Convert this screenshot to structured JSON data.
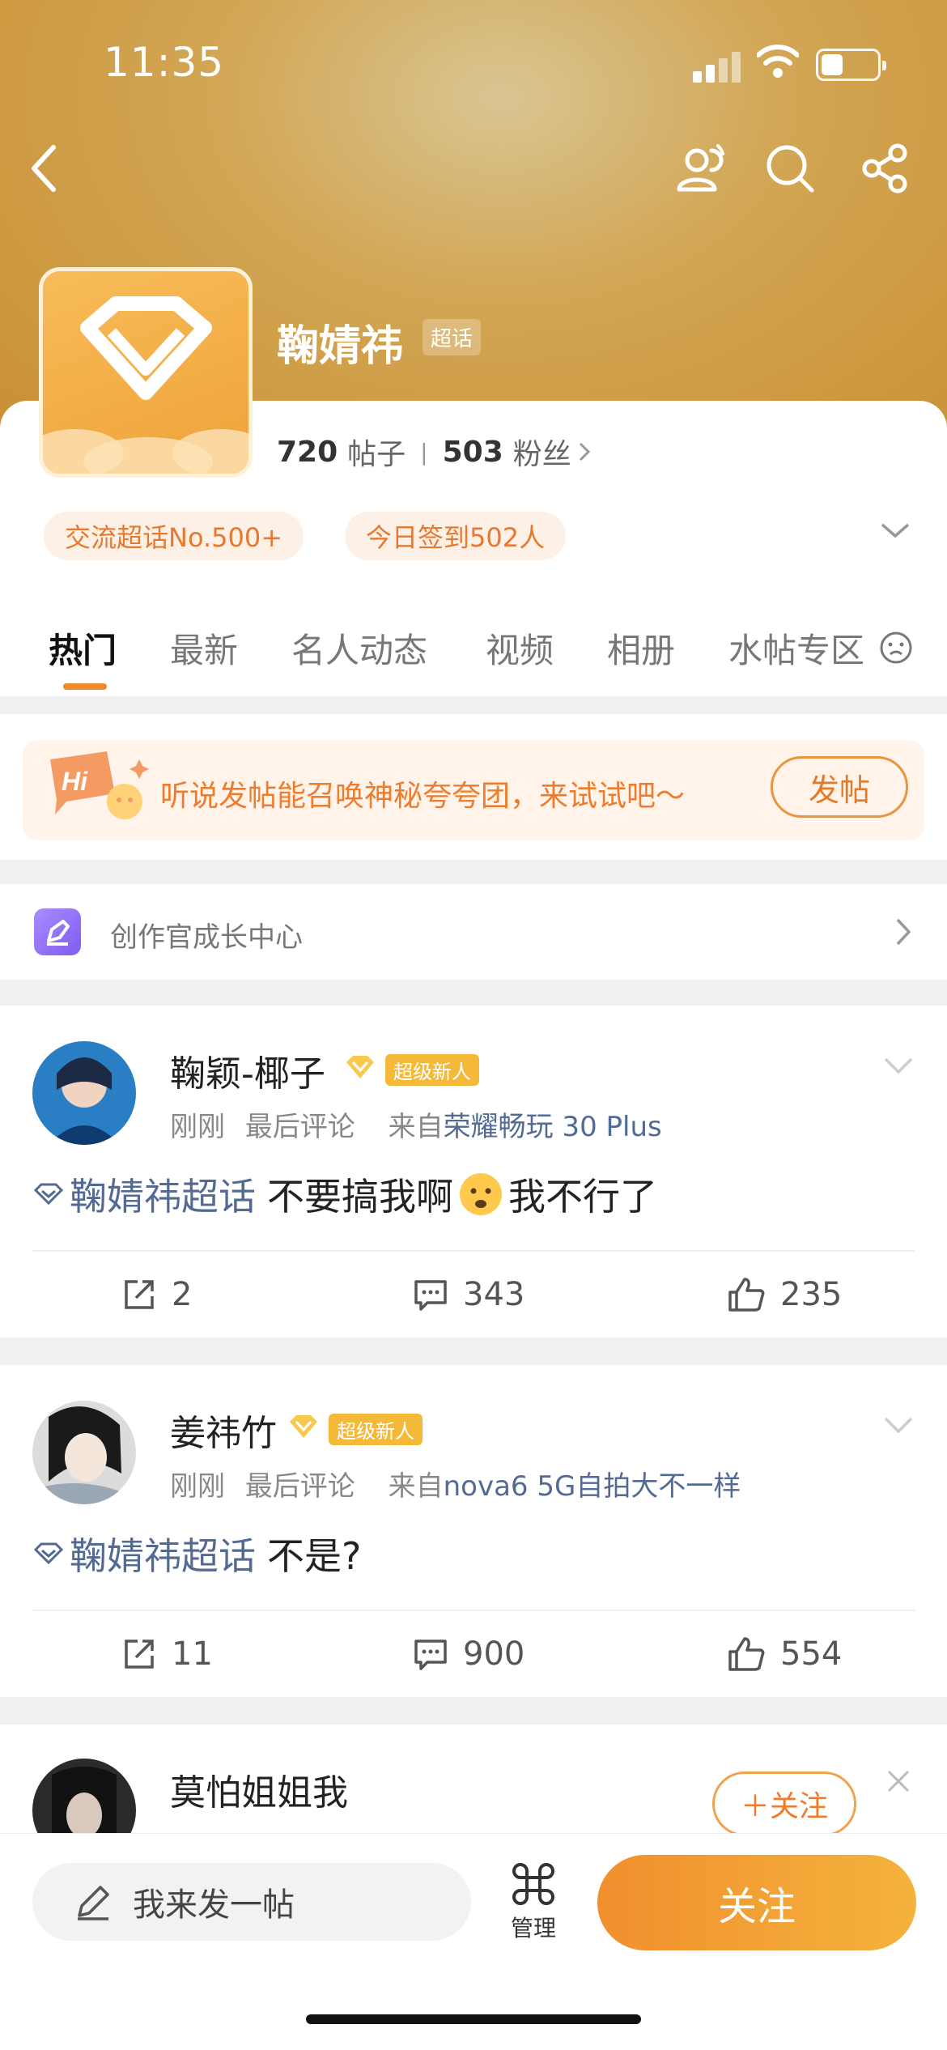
{
  "status_bar": {
    "time": "11:35"
  },
  "header": {
    "title": "鞠婧祎",
    "tag": "超话",
    "posts_count": "720",
    "posts_label": "帖子",
    "fans_count": "503",
    "fans_label": "粉丝",
    "chips": [
      "交流超话No.500+",
      "今日签到502人"
    ]
  },
  "tabs": [
    "热门",
    "最新",
    "名人动态",
    "视频",
    "相册",
    "水帖专区"
  ],
  "promo": {
    "hi_text": "Hi",
    "text": "听说发帖能召唤神秘夸夸团，来试试吧～",
    "button": "发帖"
  },
  "growth_center": {
    "label": "创作官成长中心"
  },
  "posts": [
    {
      "author": "鞠颖-椰子",
      "badge": "超级新人",
      "time": "刚刚",
      "last": "最后评论",
      "from": "来自",
      "device": "荣耀畅玩 30 Plus",
      "topic": "鞠婧祎超话",
      "text1": "不要搞我啊",
      "text2": "我不行了",
      "reposts": "2",
      "comments": "343",
      "likes": "235"
    },
    {
      "author": "姜祎竹",
      "badge": "超级新人",
      "time": "刚刚",
      "last": "最后评论",
      "from": "来自",
      "device": "nova6 5G自拍大不一样",
      "topic": "鞠婧祎超话",
      "text1": "不是?",
      "reposts": "11",
      "comments": "900",
      "likes": "554"
    },
    {
      "author": "莫怕姐姐我",
      "follow": "＋关注"
    }
  ],
  "bottom_bar": {
    "compose": "我来发一帖",
    "manage": "管理",
    "follow": "关注"
  },
  "colors": {
    "accent": "#f08a29",
    "topic": "#536a92",
    "badge": "#f5b93a"
  }
}
